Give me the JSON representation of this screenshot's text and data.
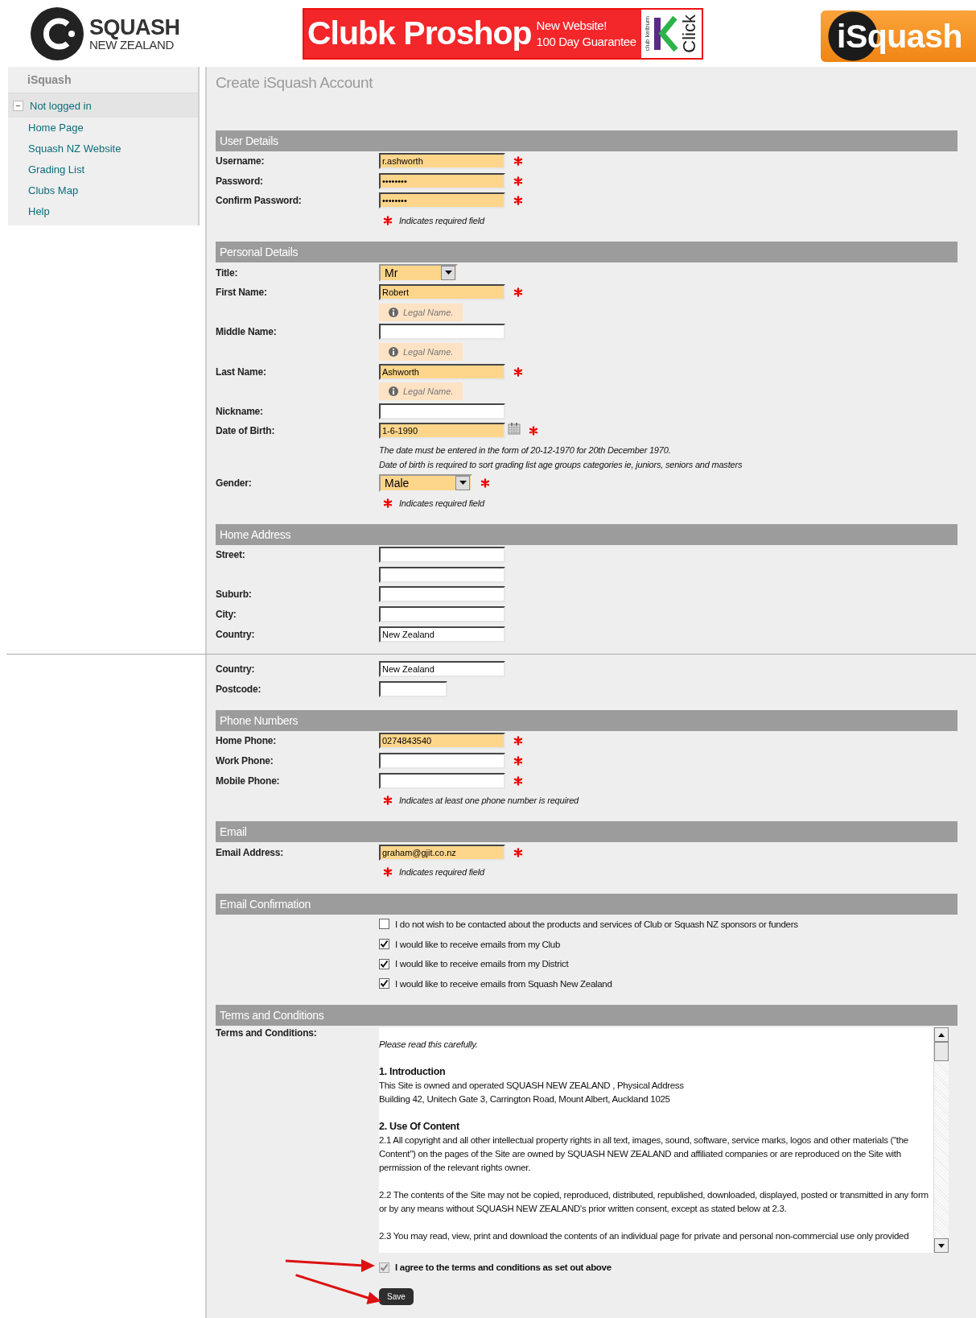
{
  "header": {
    "logo": {
      "title": "SQUASH",
      "subtitle": "NEW ZEALAND"
    },
    "banner": {
      "title": "Clubk Proshop",
      "line_1": "New Website!",
      "line_2": "100 Day Guarantee",
      "brand_small": "club kelburn",
      "brand_word": "Click"
    },
    "app_logo": "iSquash"
  },
  "sidebar": {
    "title": "iSquash",
    "group": {
      "toggle": "−",
      "label": "Not logged in",
      "expanded": true
    },
    "items": [
      {
        "label": "Home Page"
      },
      {
        "label": "Squash NZ Website"
      },
      {
        "label": "Grading List"
      },
      {
        "label": "Clubs Map"
      },
      {
        "label": "Help"
      }
    ]
  },
  "parts": [
    {
      "page_title": "Create iSquash Account",
      "sections": [
        {
          "title": "User Details",
          "rows": [
            {
              "kind": "text",
              "label": "Username:",
              "value": "r.ashworth",
              "required": true,
              "highlighted": true
            },
            {
              "kind": "password",
              "label": "Password:",
              "value": "••••••••",
              "required": true,
              "highlighted": true
            },
            {
              "kind": "password",
              "label": "Confirm Password:",
              "value": "••••••••",
              "required": true,
              "highlighted": true
            },
            {
              "kind": "note",
              "text": "Indicates required field"
            }
          ]
        },
        {
          "title": "Personal Details",
          "rows": [
            {
              "kind": "select",
              "label": "Title:",
              "value": "Mr",
              "highlighted": true
            },
            {
              "kind": "text",
              "label": "First Name:",
              "value": "Robert",
              "required": true,
              "highlighted": true
            },
            {
              "kind": "hint",
              "text": "Legal Name."
            },
            {
              "kind": "text",
              "label": "Middle Name:",
              "required": false,
              "highlighted": false
            },
            {
              "kind": "hint",
              "text": "Legal Name."
            },
            {
              "kind": "text",
              "label": "Last Name:",
              "value": "Ashworth",
              "required": true,
              "highlighted": true
            },
            {
              "kind": "hint",
              "text": "Legal Name."
            },
            {
              "kind": "text",
              "label": "Nickname:",
              "required": false,
              "highlighted": false
            },
            {
              "kind": "date",
              "label": "Date of Birth:",
              "value": "1-6-1990",
              "required": true,
              "highlighted": true
            },
            {
              "kind": "help",
              "lines": [
                "The date must be entered in the form of 20-12-1970 for 20th December 1970.",
                "Date of birth is required to sort grading list age groups categories ie, juniors, seniors and masters"
              ]
            },
            {
              "kind": "select",
              "label": "Gender:",
              "value": "Male",
              "required": true,
              "highlighted": true
            },
            {
              "kind": "note",
              "text": "Indicates required field"
            }
          ]
        },
        {
          "title": "Home Address",
          "rows": [
            {
              "kind": "text",
              "label": "Street:",
              "required": false,
              "highlighted": false
            },
            {
              "kind": "text",
              "required": false,
              "highlighted": false
            },
            {
              "kind": "text",
              "label": "Suburb:",
              "required": false,
              "highlighted": false
            },
            {
              "kind": "text",
              "label": "City:",
              "required": false,
              "highlighted": false
            },
            {
              "kind": "text",
              "label": "Country:",
              "value": "New Zealand",
              "required": false,
              "highlighted": false
            }
          ]
        }
      ]
    },
    {
      "sections": [
        {
          "rows": [
            {
              "kind": "text",
              "label": "Country:",
              "value": "New Zealand",
              "required": false,
              "highlighted": false
            },
            {
              "kind": "short_text",
              "label": "Postcode:",
              "required": false,
              "highlighted": false
            }
          ]
        },
        {
          "title": "Phone Numbers",
          "rows": [
            {
              "kind": "text",
              "label": "Home Phone:",
              "value": "0274843540",
              "required": true,
              "highlighted": true
            },
            {
              "kind": "text",
              "label": "Work Phone:",
              "required": true,
              "highlighted": false
            },
            {
              "kind": "text",
              "label": "Mobile Phone:",
              "required": true,
              "highlighted": false
            },
            {
              "kind": "note",
              "text": "Indicates at least one phone number is required"
            }
          ]
        },
        {
          "title": "Email",
          "rows": [
            {
              "kind": "text",
              "label": "Email Address:",
              "value": "graham@gjit.co.nz",
              "required": true,
              "highlighted": true
            },
            {
              "kind": "note",
              "text": "Indicates required field"
            }
          ]
        },
        {
          "title": "Email Confirmation",
          "rows": [
            {
              "kind": "checkbox",
              "label": "I do not wish to be contacted about the products and services of Club or Squash NZ sponsors or funders",
              "checked": false
            },
            {
              "kind": "checkbox",
              "label": "I would like to receive emails from my Club",
              "checked": true
            },
            {
              "kind": "checkbox",
              "label": "I would like to receive emails from my District",
              "checked": true
            },
            {
              "kind": "checkbox",
              "label": "I would like to receive emails from Squash New Zealand",
              "checked": true
            }
          ]
        },
        {
          "title": "Terms and Conditions",
          "rows": [
            {
              "kind": "terms",
              "label": "Terms and Conditions:",
              "content": [
                {
                  "kind": "intro",
                  "lines": [
                    "Please read this carefully."
                  ]
                },
                {
                  "kind": "heading",
                  "lines": [
                    "1. Introduction"
                  ]
                },
                {
                  "kind": "para",
                  "lines": [
                    "This Site is owned and operated SQUASH NEW ZEALAND , Physical Address",
                    "Building 42, Unitech Gate 3, Carrington Road, Mount Albert, Auckland 1025"
                  ]
                },
                {
                  "kind": "heading",
                  "lines": [
                    "2. Use Of Content"
                  ]
                },
                {
                  "kind": "para",
                  "lines": [
                    "2.1 All copyright and all other intellectual property rights in all text, images, sound, software, service marks, logos and other materials (\"the Content\") on the pages of the Site are owned by SQUASH NEW ZEALAND and affiliated companies or are reproduced on the Site with permission of the relevant rights owner."
                  ]
                },
                {
                  "kind": "para",
                  "lines": [
                    "2.2 The contents of the Site may not be copied, reproduced, distributed, republished, downloaded, displayed, posted or transmitted in any form or by any means without SQUASH NEW ZEALAND's prior written consent, except as stated below at 2.3."
                  ]
                },
                {
                  "kind": "para",
                  "lines": [
                    "2.3 You may read, view, print and download the contents of an individual page for private and personal non-commercial use only provided"
                  ]
                }
              ]
            },
            {
              "kind": "agree",
              "label": "I agree to the terms and conditions as set out above",
              "checked": true,
              "disabled": true,
              "annotated": true
            },
            {
              "kind": "button",
              "label": "Save",
              "annotated": true
            }
          ]
        }
      ]
    }
  ]
}
